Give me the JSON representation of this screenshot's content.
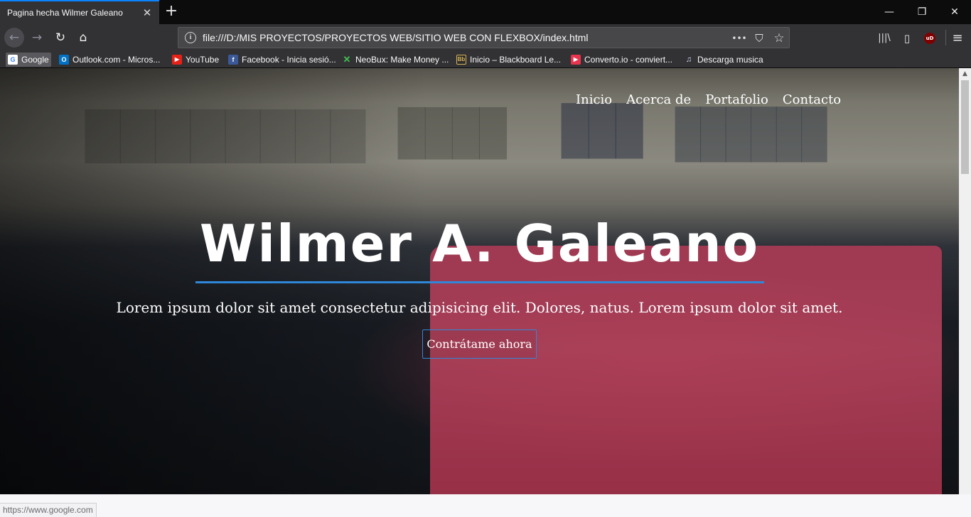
{
  "browser": {
    "tab": {
      "title": "Pagina hecha Wilmer Galeano",
      "close_glyph": "✕"
    },
    "new_tab_glyph": "+",
    "window_controls": {
      "minimize": "—",
      "restore": "❐",
      "close": "✕"
    },
    "nav": {
      "back": "←",
      "forward": "→",
      "reload": "↻",
      "home": "⌂"
    },
    "url": "file:///D:/MIS PROYECTOS/PROYECTOS WEB/SITIO WEB CON FLEXBOX/index.html",
    "url_icons": {
      "info": "i",
      "more": "•••",
      "pocket": "⛉",
      "star": "☆"
    },
    "toolbar_icons": {
      "library": "|||\\",
      "sidebar": "▯",
      "ublock": "uD",
      "menu": "≡"
    },
    "bookmarks": [
      {
        "label": "Google",
        "icon": "G",
        "color": "#4285f4"
      },
      {
        "label": "Outlook.com - Micros...",
        "icon": "O",
        "color": "#0072c6"
      },
      {
        "label": "YouTube",
        "icon": "▶",
        "color": "#e62117"
      },
      {
        "label": "Facebook - Inicia sesió...",
        "icon": "f",
        "color": "#3b5998"
      },
      {
        "label": "NeoBux: Make Money ...",
        "icon": "✕",
        "color": "#2a9d3a"
      },
      {
        "label": "Inicio – Blackboard Le...",
        "icon": "Bb",
        "color": "#3a3a3a"
      },
      {
        "label": "Converto.io - conviert...",
        "icon": "▶",
        "color": "#e8344e"
      },
      {
        "label": "Descarga musica",
        "icon": "♫",
        "color": "#323234"
      }
    ],
    "status_text": "https://www.google.com"
  },
  "site": {
    "nav": [
      "Inicio",
      "Acerca de",
      "Portafolio",
      "Contacto"
    ],
    "hero": {
      "title": "Wilmer A. Galeano",
      "subtitle": "Lorem ipsum dolor sit amet consectetur adipisicing elit. Dolores, natus. Lorem ipsum dolor sit amet.",
      "cta": "Contrátame ahora"
    },
    "accent_color": "#2f87d9"
  },
  "scrollbar": {
    "up_glyph": "▲"
  }
}
